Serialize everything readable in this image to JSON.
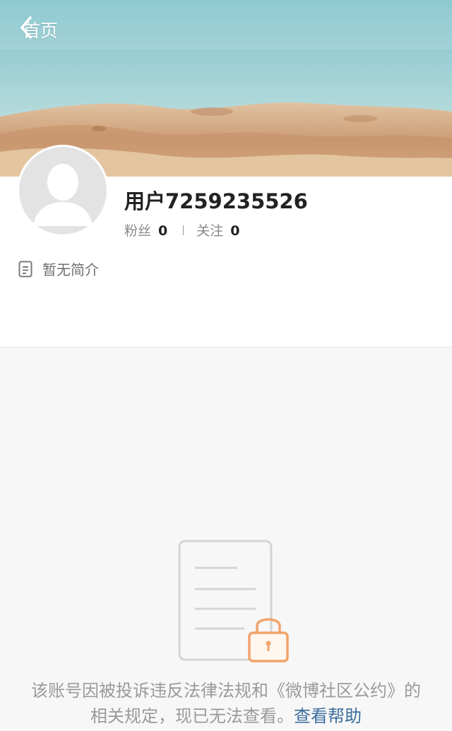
{
  "header": {
    "back_label": "首页",
    "back_icon": "chevron-left-icon"
  },
  "cover": {
    "image": "beach-sand-and-sea-photo",
    "colors": {
      "sky": "#9fd0d5",
      "sand": "#d2a27a"
    }
  },
  "profile": {
    "avatar": "default-avatar-icon",
    "username": "用户7259235526",
    "stats": [
      {
        "label": "粉丝",
        "value": "0"
      },
      {
        "label": "关注",
        "value": "0"
      }
    ],
    "bio_icon": "document-icon",
    "bio": "暂无简介"
  },
  "blocked_notice": {
    "illustration": "locked-document-icon",
    "message": "该账号因被投诉违反法律法规和《微博社区公约》的相关规定，现已无法查看。",
    "help_link": "查看帮助",
    "colors": {
      "text": "#9a9a9a",
      "link": "#3b6e9e",
      "lock": "#f2a46b"
    }
  }
}
